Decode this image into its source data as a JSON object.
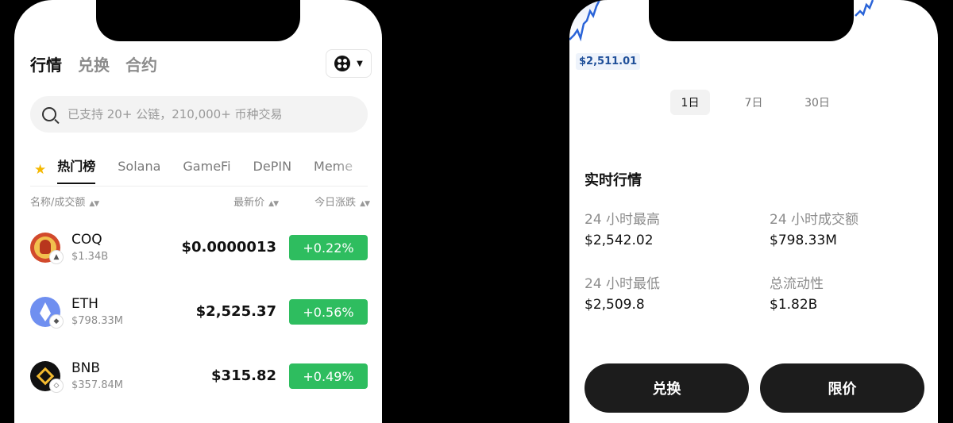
{
  "left": {
    "top_tabs": [
      "行情",
      "兑换",
      "合约"
    ],
    "search": {
      "placeholder": "已支持 20+ 公链，210,000+ 币种交易"
    },
    "categories": [
      "热门榜",
      "Solana",
      "GameFi",
      "DePIN",
      "Meme"
    ],
    "list_header": {
      "name": "名称/成交额",
      "price": "最新价",
      "change": "今日涨跌"
    },
    "coins": [
      {
        "symbol": "COQ",
        "volume": "$1.34B",
        "price": "$0.0000013",
        "change": "+0.22%",
        "icon": "coq-coin-icon",
        "chain": "avalanche-icon"
      },
      {
        "symbol": "ETH",
        "volume": "$798.33M",
        "price": "$2,525.37",
        "change": "+0.56%",
        "icon": "eth-coin-icon",
        "chain": "ethereum-icon"
      },
      {
        "symbol": "BNB",
        "volume": "$357.84M",
        "price": "$315.82",
        "change": "+0.49%",
        "icon": "bnb-coin-icon",
        "chain": "bnb-chain-icon"
      }
    ],
    "colors": {
      "up": "#2ebd5f",
      "favorite": "#f5b800"
    }
  },
  "right": {
    "chart_low_label": "$2,511.01",
    "ranges": [
      "1日",
      "7日",
      "30日"
    ],
    "section_title": "实时行情",
    "stats": [
      {
        "label": "24 小时最高",
        "value": "$2,542.02"
      },
      {
        "label": "24 小时成交额",
        "value": "$798.33M"
      },
      {
        "label": "24 小时最低",
        "value": "$2,509.8"
      },
      {
        "label": "总流动性",
        "value": "$1.82B"
      }
    ],
    "buttons": {
      "swap": "兑换",
      "limit": "限价"
    },
    "colors": {
      "chart_line": "#2a64d8"
    }
  }
}
